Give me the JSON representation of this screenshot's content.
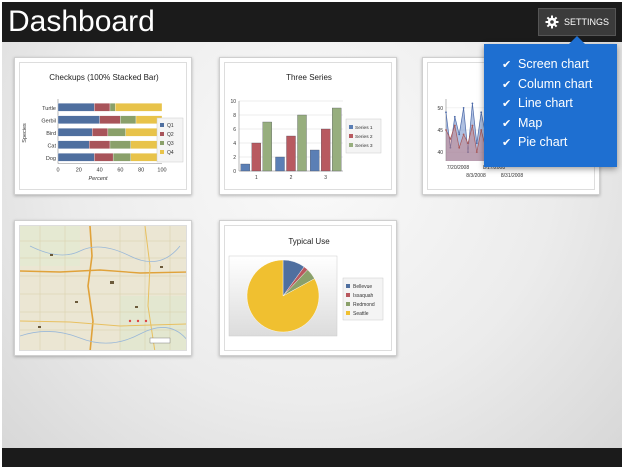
{
  "app": {
    "title": "Dashboard"
  },
  "settings": {
    "label": "SETTINGS",
    "icon": "gear-icon"
  },
  "menu": {
    "items": [
      {
        "label": "Screen chart",
        "checked": true
      },
      {
        "label": "Column chart",
        "checked": true
      },
      {
        "label": "Line chart",
        "checked": true
      },
      {
        "label": "Map",
        "checked": true
      },
      {
        "label": "Pie chart",
        "checked": true
      }
    ]
  },
  "colors": {
    "accent": "#1e6fd1",
    "bar_bg": "#1b1b1b"
  },
  "tiles": {
    "stacked": {
      "title": "Checkups (100% Stacked Bar)",
      "ylabel": "Species",
      "xlabel": "Percent",
      "categories": [
        "Turtle",
        "Gerbil",
        "Bird",
        "Cat",
        "Dog"
      ],
      "xticks": [
        "0",
        "20",
        "40",
        "60",
        "80",
        "100"
      ],
      "legend": [
        "Q1",
        "Q2",
        "Q3",
        "Q4"
      ]
    },
    "column": {
      "title": "Three Series",
      "xticks": [
        "1",
        "2",
        "3"
      ],
      "yticks": [
        "0",
        "2",
        "4",
        "6",
        "8",
        "10"
      ],
      "legend": [
        "Series 1",
        "Series 2",
        "Series 3"
      ]
    },
    "line": {
      "yticks": [
        "50",
        "45",
        "40"
      ],
      "xticks_row1": [
        "7/20/2008",
        "8/17/2008"
      ],
      "xticks_row2": [
        "8/3/2008",
        "8/31/2008"
      ]
    },
    "pie": {
      "title": "Typical Use",
      "legend": [
        "Bellevue",
        "Issaquah",
        "Redmond",
        "Seattle"
      ]
    }
  },
  "chart_data": [
    {
      "type": "bar",
      "orientation": "horizontal",
      "stacked": "percent",
      "title": "Checkups (100% Stacked Bar)",
      "xlabel": "Percent",
      "ylabel": "Species",
      "categories": [
        "Turtle",
        "Gerbil",
        "Bird",
        "Cat",
        "Dog"
      ],
      "xlim": [
        0,
        100
      ],
      "series": [
        {
          "name": "Q1",
          "values": [
            35,
            40,
            33,
            30,
            35
          ]
        },
        {
          "name": "Q2",
          "values": [
            15,
            20,
            15,
            20,
            18
          ]
        },
        {
          "name": "Q3",
          "values": [
            5,
            15,
            17,
            20,
            17
          ]
        },
        {
          "name": "Q4",
          "values": [
            45,
            25,
            35,
            30,
            30
          ]
        }
      ],
      "legend": "right"
    },
    {
      "type": "bar",
      "title": "Three Series",
      "categories": [
        "1",
        "2",
        "3"
      ],
      "ylim": [
        0,
        10
      ],
      "series": [
        {
          "name": "Series 1",
          "values": [
            1,
            2,
            3
          ]
        },
        {
          "name": "Series 2",
          "values": [
            4,
            5,
            6
          ]
        },
        {
          "name": "Series 3",
          "values": [
            7,
            8,
            9
          ]
        }
      ],
      "legend": "right",
      "grid": true
    },
    {
      "type": "area",
      "x": [
        "7/20/2008",
        "8/3/2008",
        "8/17/2008",
        "8/31/2008"
      ],
      "ylim": [
        38,
        52
      ],
      "series": [
        {
          "values": [
            49,
            41,
            48,
            44,
            50,
            40,
            51,
            42,
            49,
            44,
            50,
            45,
            50,
            46,
            51,
            47
          ]
        },
        {
          "values": [
            45,
            43,
            46,
            41,
            44,
            42,
            46,
            40,
            45,
            41,
            44,
            40,
            43,
            41,
            42,
            40
          ]
        }
      ]
    },
    {
      "type": "pie",
      "title": "Typical Use",
      "labels": [
        "Bellevue",
        "Issaquah",
        "Redmond",
        "Seattle"
      ],
      "values": [
        10,
        2,
        5,
        83
      ],
      "legend": "right"
    }
  ]
}
